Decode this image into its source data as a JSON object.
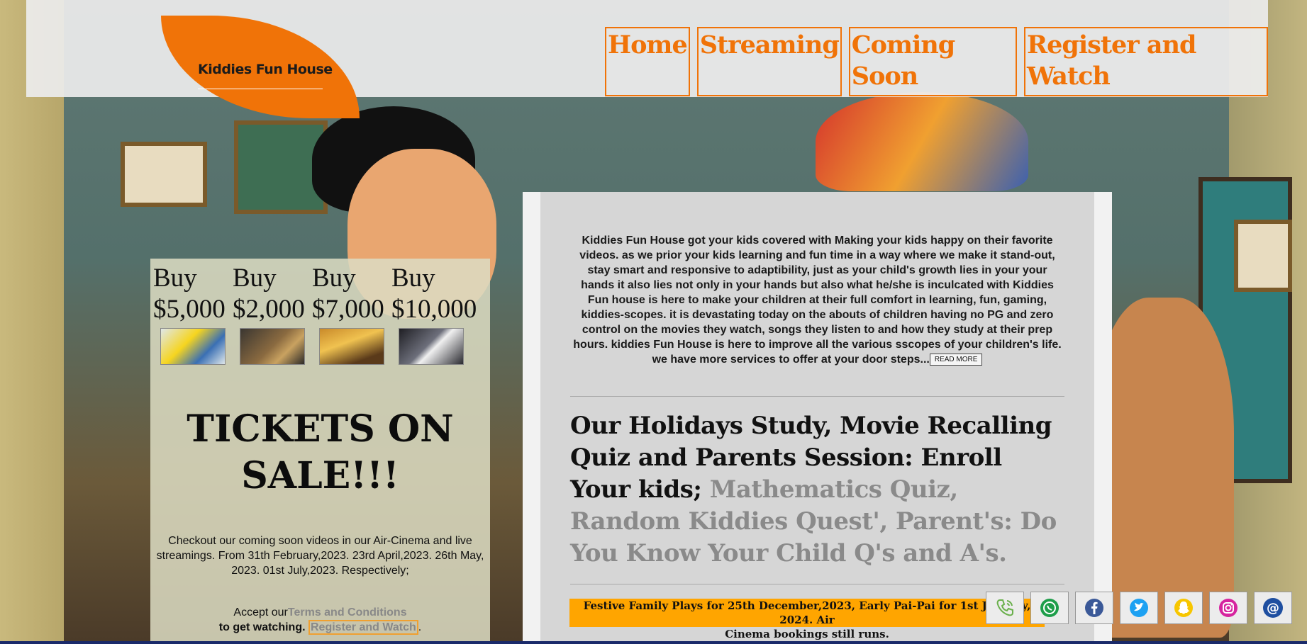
{
  "brand": {
    "name": "Kiddies Fun House"
  },
  "nav": {
    "home": "Home",
    "streaming": "Streaming",
    "coming_soon": "Coming Soon",
    "register": "Register and Watch"
  },
  "tickets": {
    "buys": [
      {
        "label": "Buy",
        "price": "$5,000"
      },
      {
        "label": "Buy",
        "price": "$2,000"
      },
      {
        "label": "Buy",
        "price": "$7,000"
      },
      {
        "label": "Buy",
        "price": "$10,000"
      }
    ],
    "headline_line1": "TICKETS ON",
    "headline_line2": "SALE!!!",
    "description": "Checkout our coming soon videos in our Air-Cinema and live streamings. From 31th February,2023. 23rd April,2023. 26th May, 2023. 01st July,2023. Respectively;",
    "accept_prefix": "Accept our",
    "terms_link": "Terms and Conditions",
    "watch_text": "to get watching.",
    "register_link": "Register and Watch",
    "period": "."
  },
  "info": {
    "about": "Kiddies Fun House got your kids covered with Making your kids happy on their favorite videos. as we prior your kids learning and fun time in a way where we make it stand-out, stay smart and responsive to adaptibility, just as your child's growth lies in your your hands it also lies not only in your hands but also what he/she is inculcated with Kiddies Fun house is here to make your children at their full comfort in learning, fun, gaming, kiddies-scopes. it is devastating today on the abouts of children having no PG and zero control on the movies they watch, songs they listen to and how they study at their prep hours. kiddies Fun House is here to improve all the various sscopes of your children's life. we have more services to offer at your door steps...",
    "read_more": "READ MORE",
    "study_dark": "Our Holidays Study, Movie Recalling Quiz and Parents Session: Enroll Your kids;",
    "study_grey": "Mathematics Quiz, Random Kiddies Quest', Parent's: Do You Know Your Child Q's and A's.",
    "festive_line1": "Festive Family Plays for 25th December,2023, Early Pai-Pai for 1st January, 2024. Air",
    "festive_line2": "Cinema bookings still runs."
  },
  "social": [
    {
      "icon": "phone-icon",
      "color": "#6ab04c"
    },
    {
      "icon": "whatsapp-icon",
      "color": "#1e9e4a"
    },
    {
      "icon": "facebook-icon",
      "color": "#3b5998"
    },
    {
      "icon": "twitter-icon",
      "color": "#1da1f2"
    },
    {
      "icon": "snapchat-icon",
      "color": "#f7c600"
    },
    {
      "icon": "instagram-icon",
      "color": "#d6249f"
    },
    {
      "icon": "email-icon",
      "color": "#1f4fa0"
    }
  ],
  "colors": {
    "accent": "#f07308",
    "festive_bg": "#ffa500"
  }
}
